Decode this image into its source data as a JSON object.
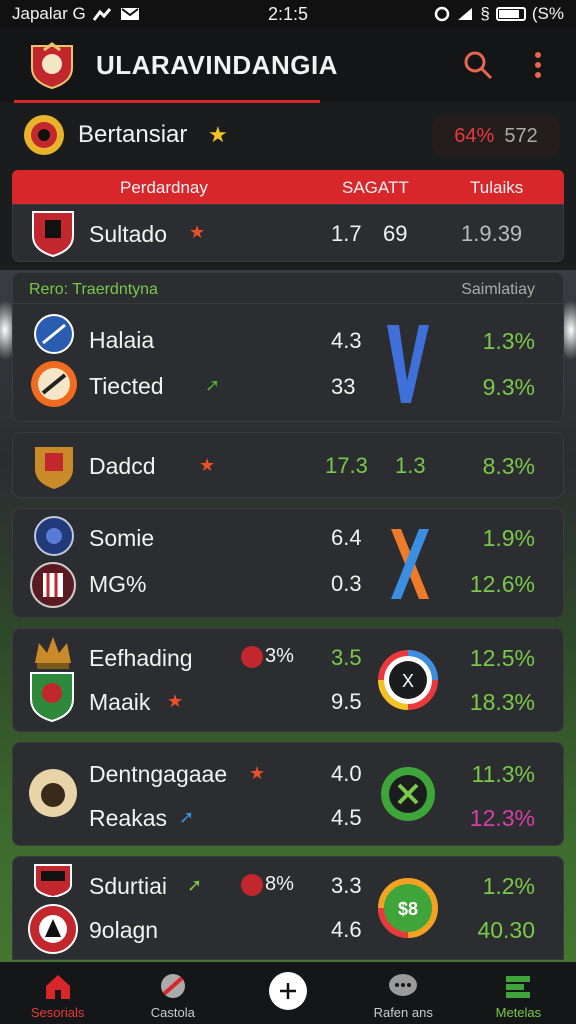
{
  "status_bar": {
    "carrier": "Japalar G",
    "time": "2:1:5",
    "battery": "(S%"
  },
  "app": {
    "title": "ULARAVINDANGIA"
  },
  "section": {
    "title": "Bertansiar",
    "pill_value": "64%",
    "pill_count": "572"
  },
  "table_header": {
    "col1": "Perdardnay",
    "col2": "SAGATT",
    "col3": "Tulaiks"
  },
  "featured": {
    "team": "Sultado",
    "v1": "1.7",
    "v2": "69",
    "v3": "1.9.39"
  },
  "group": {
    "label": "Rero: Traerdntyna",
    "right_label": "Saimlatiay"
  },
  "matches": [
    {
      "home": "Halaia",
      "away": "Tiected",
      "h1": "4.3",
      "a1": "33",
      "h3": "1.3%",
      "a3": "9.3%",
      "badge": ""
    },
    {
      "home": "Dadcd",
      "h1": "17.3",
      "h2": "1.3",
      "h3": "8.3%"
    },
    {
      "home": "Somie",
      "away": "MG%",
      "h1": "6.4",
      "a1": "0.3",
      "h3": "1.9%",
      "a3": "12.6%"
    },
    {
      "home": "Eefhading",
      "away": "Maaik",
      "badge": "3%",
      "h1": "3.5",
      "a1": "9.5",
      "h3": "12.5%",
      "a3": "18.3%",
      "mid": "X"
    },
    {
      "home": "Dentngagaae",
      "away": "Reakas",
      "h1": "4.0",
      "a1": "4.5",
      "h3": "11.3%",
      "a3": "12.3%"
    },
    {
      "home": "Sdurtiai",
      "away": "9olagn",
      "badge": "8%",
      "h1": "3.3",
      "a1": "4.6",
      "h3": "1.2%",
      "a3": "40.30",
      "mid": "$8"
    }
  ],
  "tabs": [
    {
      "label": "Sesorials",
      "icon": "home-icon"
    },
    {
      "label": "Castola",
      "icon": "ball-icon"
    },
    {
      "label": "",
      "icon": "plus-icon"
    },
    {
      "label": "Rafen ans",
      "icon": "chat-icon"
    },
    {
      "label": "Metelas",
      "icon": "stats-icon"
    }
  ],
  "colors": {
    "accent": "#d8272b",
    "positive": "#79c84a",
    "negative": "#d63fa5"
  }
}
